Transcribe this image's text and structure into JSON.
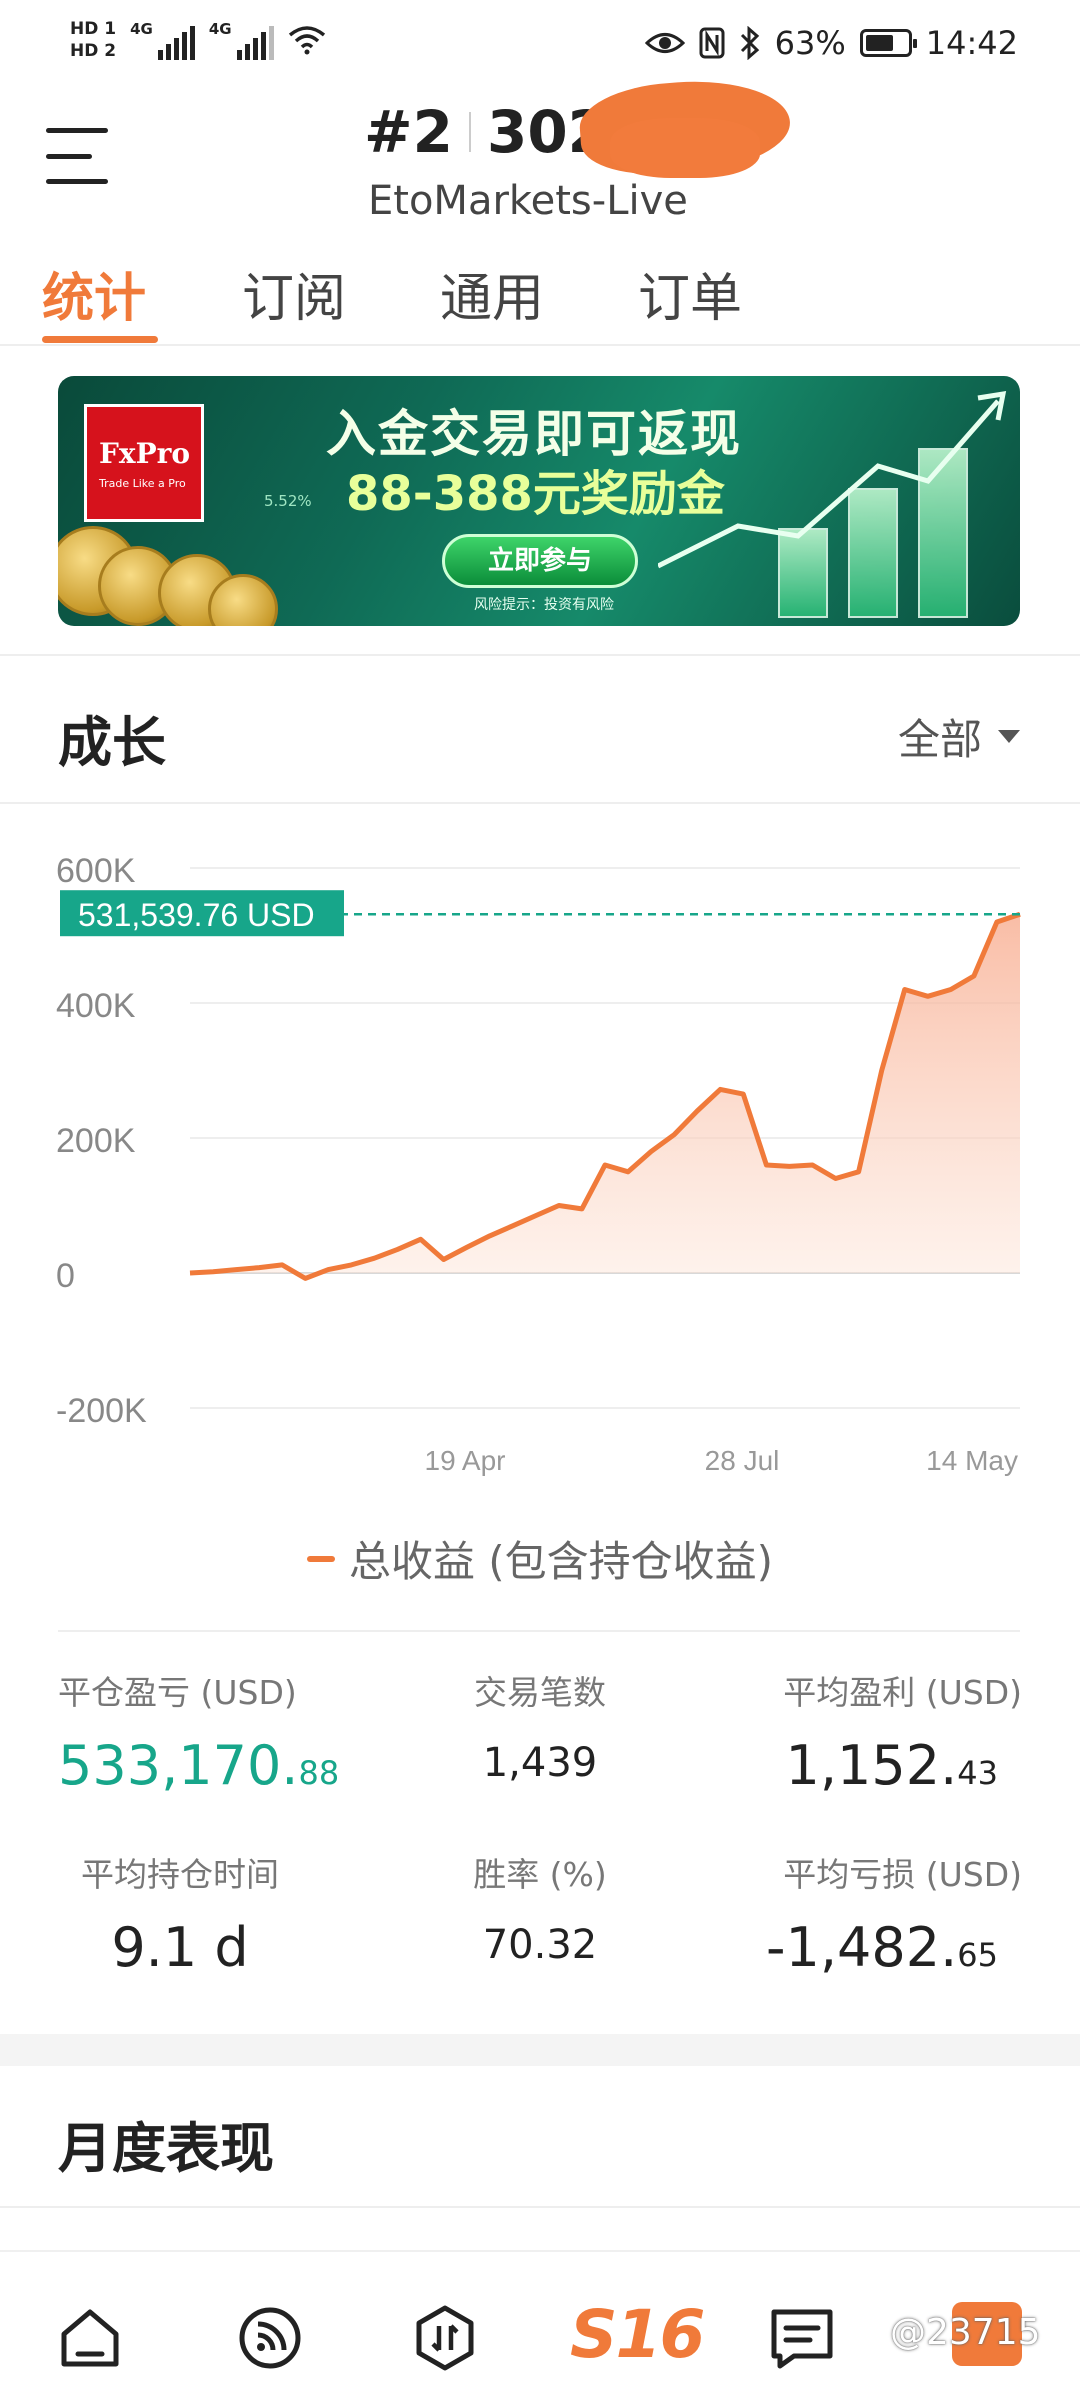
{
  "status_bar": {
    "hd_top": "HD 1",
    "hd_bottom": "HD 2",
    "net1": "4G",
    "net2": "4G",
    "battery_pct": "63%",
    "time": "14:42",
    "icons": [
      "eye-icon",
      "nfc-icon",
      "bluetooth-icon",
      "battery-icon",
      "wifi-icon"
    ]
  },
  "header": {
    "account": "#2",
    "account_partial": "302",
    "server": "EtoMarkets-Live"
  },
  "tabs": [
    {
      "label": "统计",
      "active": true
    },
    {
      "label": "订阅",
      "active": false
    },
    {
      "label": "通用",
      "active": false
    },
    {
      "label": "订单",
      "active": false
    }
  ],
  "banner": {
    "logo_name": "FxPro",
    "logo_tagline": "Trade Like a Pro",
    "title": "入金交易即可返现",
    "subtitle": "88-388元奖励金",
    "button": "立即参与",
    "risk_note": "风险提示：投资有风险",
    "pct": "5.52%"
  },
  "growth": {
    "title": "成长",
    "filter": "全部"
  },
  "chart_data": {
    "type": "area",
    "series": [
      {
        "name": "总收益 (包含持仓收益)",
        "color": "#f07a3a",
        "y": [
          0,
          2000,
          5000,
          8000,
          12000,
          -8000,
          5000,
          12000,
          22000,
          35000,
          50000,
          20000,
          38000,
          55000,
          70000,
          85000,
          100000,
          95000,
          160000,
          150000,
          180000,
          205000,
          240000,
          272000,
          265000,
          160000,
          158000,
          160000,
          140000,
          150000,
          300000,
          420000,
          410000,
          420000,
          440000,
          520000,
          531539.76
        ]
      }
    ],
    "x_ticks": [
      "19 Apr",
      "28 Jul",
      "14 May"
    ],
    "y_ticks": [
      "600K",
      "400K",
      "200K",
      "0",
      "-200K"
    ],
    "ylim": [
      -200000,
      600000
    ],
    "current_value_label": "531,539.76 USD",
    "current_value": 531539.76,
    "legend": "总收益 (包含持仓收益)",
    "grid": true
  },
  "stats": {
    "closed_pl_label": "平仓盈亏 (USD)",
    "closed_pl_main": "533,170.",
    "closed_pl_dec": "88",
    "trades_label": "交易笔数",
    "trades_value": "1,439",
    "avg_profit_label": "平均盈利 (USD)",
    "avg_profit_main": "1,152.",
    "avg_profit_dec": "43",
    "avg_hold_label": "平均持仓时间",
    "avg_hold_value": "9.1 d",
    "win_rate_label": "胜率 (%)",
    "win_rate_value": "70.32",
    "avg_loss_label": "平均亏损 (USD)",
    "avg_loss_main": "-1,482.",
    "avg_loss_dec": "65"
  },
  "monthly": {
    "title": "月度表现"
  },
  "bottom_nav": {
    "center_label": "S16",
    "watermark": "@23715"
  },
  "colors": {
    "accent": "#f07a3a",
    "green": "#17a68a",
    "chart_fill": "#fde1d4"
  }
}
